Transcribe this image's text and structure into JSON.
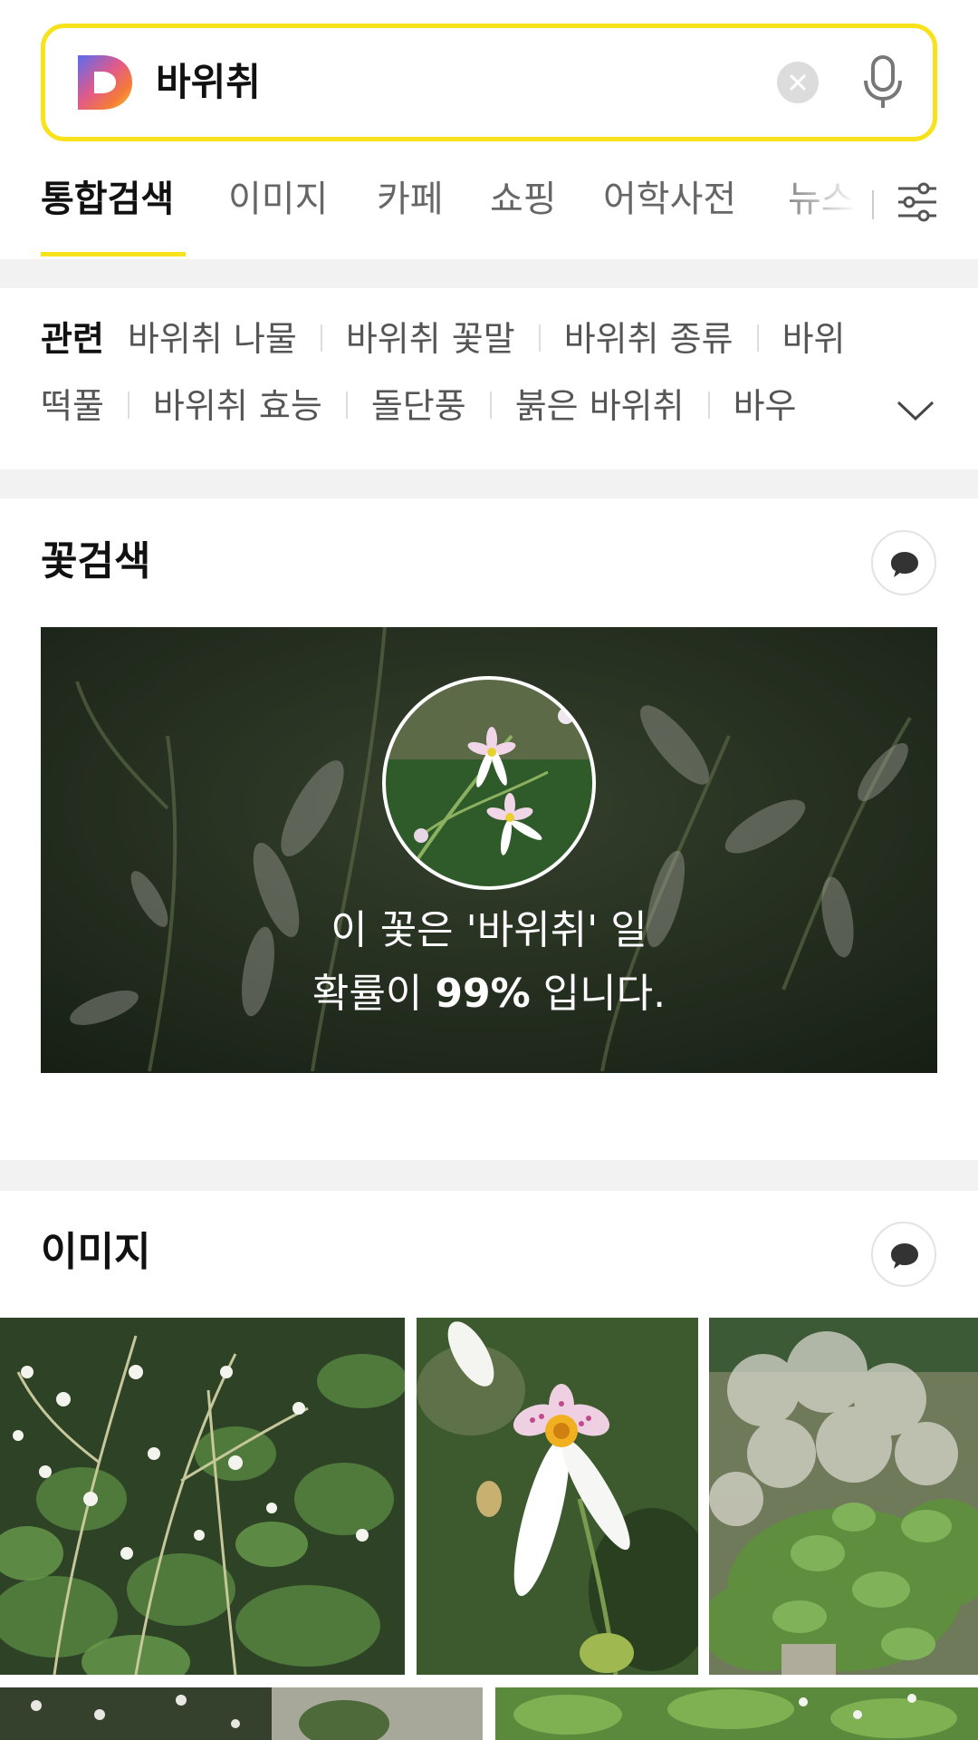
{
  "search": {
    "query": "바위취"
  },
  "tabs": [
    {
      "label": "통합검색",
      "active": true
    },
    {
      "label": "이미지"
    },
    {
      "label": "카페"
    },
    {
      "label": "쇼핑"
    },
    {
      "label": "어학사전"
    },
    {
      "label": "뉴스"
    }
  ],
  "related": {
    "heading": "관련",
    "row1": [
      "바위취 나물",
      "바위취 꽃말",
      "바위취 종류",
      "바위"
    ],
    "row2": [
      "떡풀",
      "바위취 효능",
      "돌단풍",
      "붉은 바위취",
      "바우"
    ]
  },
  "flower_search": {
    "title": "꽃검색",
    "line1": "이 꽃은 '바위취' 일",
    "line2_prefix": "확률이 ",
    "probability": "99%",
    "line2_suffix": " 입니다."
  },
  "images": {
    "title": "이미지"
  },
  "colors": {
    "accent": "#f7e21b",
    "divider": "#f2f2f2"
  },
  "icons": [
    "daum-logo-icon",
    "clear-icon",
    "mic-icon",
    "filter-icon",
    "chevron-down-icon",
    "chat-bubble-icon"
  ]
}
